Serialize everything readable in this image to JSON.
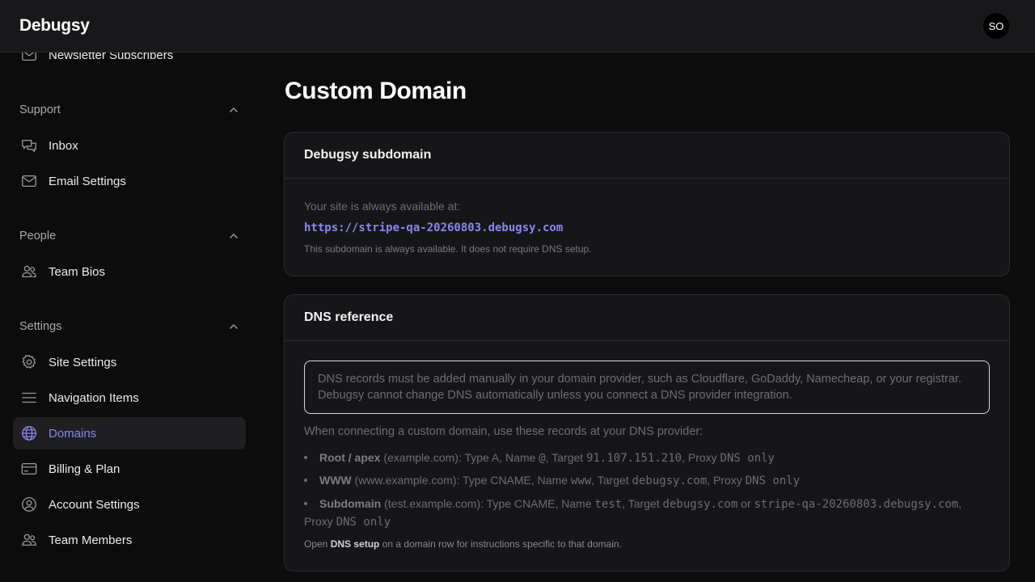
{
  "header": {
    "brand": "Debugsy",
    "avatar_initials": "SO"
  },
  "sidebar": {
    "partial_item": {
      "label": "Newsletter Subscribers",
      "icon": "mail-icon"
    },
    "sections": [
      {
        "title": "Support",
        "items": [
          {
            "label": "Inbox",
            "icon": "chat-icon"
          },
          {
            "label": "Email Settings",
            "icon": "mail-icon"
          }
        ]
      },
      {
        "title": "People",
        "items": [
          {
            "label": "Team Bios",
            "icon": "people-icon"
          }
        ]
      },
      {
        "title": "Settings",
        "items": [
          {
            "label": "Site Settings",
            "icon": "gear-icon"
          },
          {
            "label": "Navigation Items",
            "icon": "menu-icon"
          },
          {
            "label": "Domains",
            "icon": "globe-icon",
            "active": true
          },
          {
            "label": "Billing & Plan",
            "icon": "credit-card-icon"
          },
          {
            "label": "Account Settings",
            "icon": "user-circle-icon"
          },
          {
            "label": "Team Members",
            "icon": "people-icon"
          }
        ]
      }
    ]
  },
  "main": {
    "title": "Custom Domain",
    "subdomain_card": {
      "title": "Debugsy subdomain",
      "label": "Your site is always available at:",
      "url": "https://stripe-qa-20260803.debugsy.com",
      "note": "This subdomain is always available. It does not require DNS setup."
    },
    "dns_card": {
      "title": "DNS reference",
      "notice": "DNS records must be added manually in your domain provider, such as Cloudflare, GoDaddy, Namecheap, or your registrar. Debugsy cannot change DNS automatically unless you connect a DNS provider integration.",
      "intro": "When connecting a custom domain, use these records at your DNS provider:",
      "records": [
        {
          "name": "Root / apex",
          "example": " (example.com): Type A, Name ",
          "name_value": "@",
          "target_label": ", Target ",
          "target": "91.107.151.210",
          "proxy_label": ", Proxy ",
          "proxy": "DNS only"
        },
        {
          "name": "WWW",
          "example": " (www.example.com): Type CNAME, Name ",
          "name_value": "www",
          "target_label": ", Target ",
          "target": "debugsy.com",
          "proxy_label": ", Proxy ",
          "proxy": "DNS only"
        },
        {
          "name": "Subdomain",
          "example": " (test.example.com): Type CNAME, Name ",
          "name_value": "test",
          "target_label": ", Target ",
          "target": "debugsy.com",
          "or_label": " or ",
          "target_alt": "stripe-qa-20260803.debugsy.com",
          "proxy_label": "Proxy ",
          "proxy": "DNS only"
        }
      ],
      "footer_prefix": "Open ",
      "footer_bold": "DNS setup",
      "footer_suffix": " on a domain row for instructions specific to that domain."
    }
  },
  "colors": {
    "accent": "#8b87f0",
    "background": "#0c0c0d",
    "card": "#161618",
    "topbar": "#18181a"
  }
}
